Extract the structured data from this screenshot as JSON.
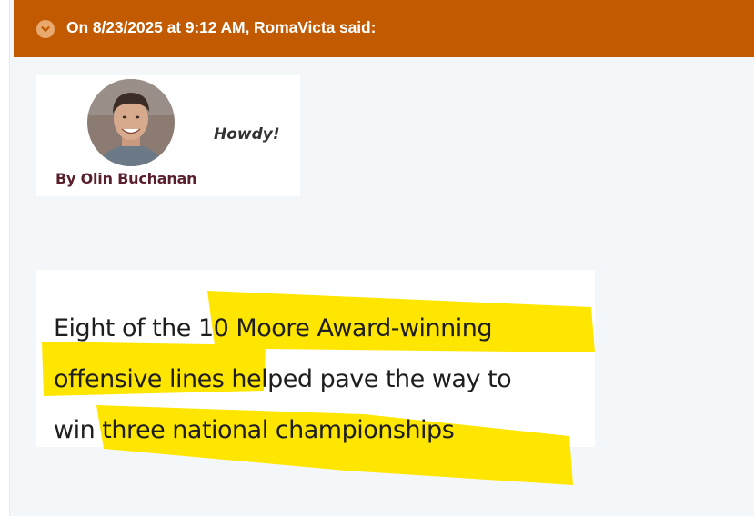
{
  "quote": {
    "attribution": "On 8/23/2025 at 9:12 AM, RomaVicta said:",
    "toggle_icon": "chevron-down-icon",
    "header_color": "#c15a00"
  },
  "byline_card": {
    "greeting": "Howdy!",
    "author": "By Olin Buchanan",
    "avatar_icon": "author-photo"
  },
  "snippet": {
    "lines": [
      "Eight of the 10 Moore Award-winning",
      "offensive lines helped pave the way to",
      "win three national championships"
    ],
    "highlight_color": "#ffe600"
  }
}
